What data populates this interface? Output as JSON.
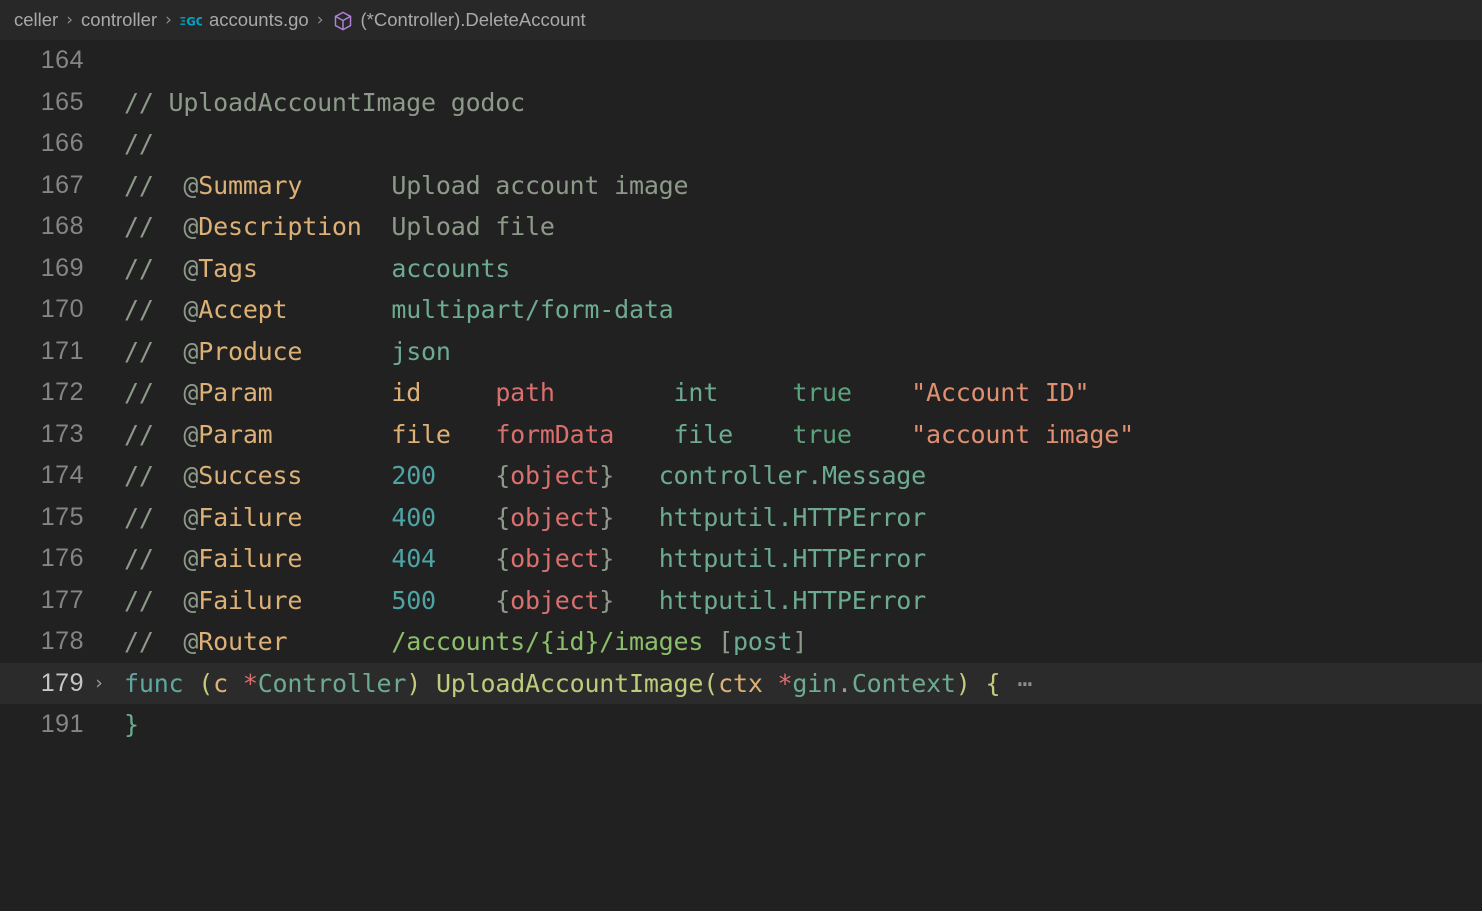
{
  "breadcrumb": {
    "separator": "›",
    "items": [
      {
        "label": "celler",
        "icon": null
      },
      {
        "label": "controller",
        "icon": null
      },
      {
        "label": "accounts.go",
        "icon": "go-file-icon"
      },
      {
        "label": "(*Controller).DeleteAccount",
        "icon": "symbol-cube-icon"
      }
    ]
  },
  "editor": {
    "fold_chevron": "›",
    "fold_ellipsis": "⋯",
    "lines": [
      {
        "num": "164",
        "fold": false,
        "folded": false,
        "tokens": []
      },
      {
        "num": "165",
        "fold": false,
        "folded": false,
        "tokens": [
          {
            "c": "t-comment",
            "t": "// UploadAccountImage godoc"
          }
        ]
      },
      {
        "num": "166",
        "fold": false,
        "folded": false,
        "tokens": [
          {
            "c": "t-comment",
            "t": "//"
          }
        ]
      },
      {
        "num": "167",
        "fold": false,
        "folded": false,
        "tokens": [
          {
            "c": "t-comment",
            "t": "//  @"
          },
          {
            "c": "t-tag",
            "t": "Summary"
          },
          {
            "c": "t-comment",
            "t": "      Upload account image"
          }
        ]
      },
      {
        "num": "168",
        "fold": false,
        "folded": false,
        "tokens": [
          {
            "c": "t-comment",
            "t": "//  @"
          },
          {
            "c": "t-tag",
            "t": "Description"
          },
          {
            "c": "t-comment",
            "t": "  Upload file"
          }
        ]
      },
      {
        "num": "169",
        "fold": false,
        "folded": false,
        "tokens": [
          {
            "c": "t-comment",
            "t": "//  @"
          },
          {
            "c": "t-tag",
            "t": "Tags"
          },
          {
            "c": "t-comment",
            "t": "         "
          },
          {
            "c": "t-type",
            "t": "accounts"
          }
        ]
      },
      {
        "num": "170",
        "fold": false,
        "folded": false,
        "tokens": [
          {
            "c": "t-comment",
            "t": "//  @"
          },
          {
            "c": "t-tag",
            "t": "Accept"
          },
          {
            "c": "t-comment",
            "t": "       "
          },
          {
            "c": "t-type",
            "t": "multipart/form-data"
          }
        ]
      },
      {
        "num": "171",
        "fold": false,
        "folded": false,
        "tokens": [
          {
            "c": "t-comment",
            "t": "//  @"
          },
          {
            "c": "t-tag",
            "t": "Produce"
          },
          {
            "c": "t-comment",
            "t": "      "
          },
          {
            "c": "t-type",
            "t": "json"
          }
        ]
      },
      {
        "num": "172",
        "fold": false,
        "folded": false,
        "tokens": [
          {
            "c": "t-comment",
            "t": "//  @"
          },
          {
            "c": "t-tag",
            "t": "Param"
          },
          {
            "c": "t-comment",
            "t": "        "
          },
          {
            "c": "t-param",
            "t": "id"
          },
          {
            "c": "t-comment",
            "t": "     "
          },
          {
            "c": "t-salmon",
            "t": "path"
          },
          {
            "c": "t-comment",
            "t": "        "
          },
          {
            "c": "t-type",
            "t": "int"
          },
          {
            "c": "t-comment",
            "t": "     "
          },
          {
            "c": "t-bool",
            "t": "true"
          },
          {
            "c": "t-comment",
            "t": "    "
          },
          {
            "c": "t-string",
            "t": "\"Account ID\""
          }
        ]
      },
      {
        "num": "173",
        "fold": false,
        "folded": false,
        "tokens": [
          {
            "c": "t-comment",
            "t": "//  @"
          },
          {
            "c": "t-tag",
            "t": "Param"
          },
          {
            "c": "t-comment",
            "t": "        "
          },
          {
            "c": "t-param",
            "t": "file"
          },
          {
            "c": "t-comment",
            "t": "   "
          },
          {
            "c": "t-salmon",
            "t": "formData"
          },
          {
            "c": "t-comment",
            "t": "    "
          },
          {
            "c": "t-type",
            "t": "file"
          },
          {
            "c": "t-comment",
            "t": "    "
          },
          {
            "c": "t-bool",
            "t": "true"
          },
          {
            "c": "t-comment",
            "t": "    "
          },
          {
            "c": "t-string",
            "t": "\"account image\""
          }
        ]
      },
      {
        "num": "174",
        "fold": false,
        "folded": false,
        "tokens": [
          {
            "c": "t-comment",
            "t": "//  @"
          },
          {
            "c": "t-tag",
            "t": "Success"
          },
          {
            "c": "t-comment",
            "t": "      "
          },
          {
            "c": "t-number",
            "t": "200"
          },
          {
            "c": "t-comment",
            "t": "    {"
          },
          {
            "c": "t-salmon",
            "t": "object"
          },
          {
            "c": "t-comment",
            "t": "}   "
          },
          {
            "c": "t-type",
            "t": "controller.Message"
          }
        ]
      },
      {
        "num": "175",
        "fold": false,
        "folded": false,
        "tokens": [
          {
            "c": "t-comment",
            "t": "//  @"
          },
          {
            "c": "t-tag",
            "t": "Failure"
          },
          {
            "c": "t-comment",
            "t": "      "
          },
          {
            "c": "t-number",
            "t": "400"
          },
          {
            "c": "t-comment",
            "t": "    {"
          },
          {
            "c": "t-salmon",
            "t": "object"
          },
          {
            "c": "t-comment",
            "t": "}   "
          },
          {
            "c": "t-type",
            "t": "httputil.HTTPError"
          }
        ]
      },
      {
        "num": "176",
        "fold": false,
        "folded": false,
        "tokens": [
          {
            "c": "t-comment",
            "t": "//  @"
          },
          {
            "c": "t-tag",
            "t": "Failure"
          },
          {
            "c": "t-comment",
            "t": "      "
          },
          {
            "c": "t-number",
            "t": "404"
          },
          {
            "c": "t-comment",
            "t": "    {"
          },
          {
            "c": "t-salmon",
            "t": "object"
          },
          {
            "c": "t-comment",
            "t": "}   "
          },
          {
            "c": "t-type",
            "t": "httputil.HTTPError"
          }
        ]
      },
      {
        "num": "177",
        "fold": false,
        "folded": false,
        "tokens": [
          {
            "c": "t-comment",
            "t": "//  @"
          },
          {
            "c": "t-tag",
            "t": "Failure"
          },
          {
            "c": "t-comment",
            "t": "      "
          },
          {
            "c": "t-number",
            "t": "500"
          },
          {
            "c": "t-comment",
            "t": "    {"
          },
          {
            "c": "t-salmon",
            "t": "object"
          },
          {
            "c": "t-comment",
            "t": "}   "
          },
          {
            "c": "t-type",
            "t": "httputil.HTTPError"
          }
        ]
      },
      {
        "num": "178",
        "fold": false,
        "folded": false,
        "tokens": [
          {
            "c": "t-comment",
            "t": "//  @"
          },
          {
            "c": "t-tag",
            "t": "Router"
          },
          {
            "c": "t-comment",
            "t": "       "
          },
          {
            "c": "t-path",
            "t": "/accounts/{id}/images"
          },
          {
            "c": "t-comment",
            "t": " ["
          },
          {
            "c": "t-type",
            "t": "post"
          },
          {
            "c": "t-comment",
            "t": "]"
          }
        ]
      },
      {
        "num": "179",
        "fold": true,
        "folded": true,
        "tokens": [
          {
            "c": "t-keyword",
            "t": "func"
          },
          {
            "c": "t-punct",
            "t": " "
          },
          {
            "c": "t-bracket1",
            "t": "("
          },
          {
            "c": "t-param",
            "t": "c"
          },
          {
            "c": "t-punct",
            "t": " "
          },
          {
            "c": "t-salmon",
            "t": "*"
          },
          {
            "c": "t-type",
            "t": "Controller"
          },
          {
            "c": "t-bracket1",
            "t": ")"
          },
          {
            "c": "t-punct",
            "t": " "
          },
          {
            "c": "t-func",
            "t": "UploadAccountImage"
          },
          {
            "c": "t-bracket1",
            "t": "("
          },
          {
            "c": "t-param",
            "t": "ctx"
          },
          {
            "c": "t-punct",
            "t": " "
          },
          {
            "c": "t-salmon",
            "t": "*"
          },
          {
            "c": "t-type",
            "t": "gin"
          },
          {
            "c": "t-punct",
            "t": "."
          },
          {
            "c": "t-type",
            "t": "Context"
          },
          {
            "c": "t-bracket1",
            "t": ")"
          },
          {
            "c": "t-punct",
            "t": " "
          },
          {
            "c": "t-bracket1",
            "t": "{"
          },
          {
            "c": "t-fold",
            "t": " ⋯"
          }
        ]
      },
      {
        "num": "191",
        "fold": false,
        "folded": false,
        "tokens": [
          {
            "c": "t-bracket2",
            "t": "}"
          }
        ]
      }
    ]
  },
  "colors": {
    "editor_background": "#212121",
    "breadcrumb_background": "#282828",
    "folded_line_background": "#2b2b2b",
    "line_number": "#858585",
    "active_line_number": "#c6c6c6",
    "comment": "#8d9a8a",
    "annotation_tag": "#ddb176",
    "string": "#e08f70",
    "type": "#6dab91",
    "number": "#4ea3a3",
    "boolean": "#5ba37d",
    "operator_star": "#d9706f",
    "route_path": "#8bbf6a",
    "bracket_level_1": "#c5c97b",
    "bracket_level_2": "#6dab91",
    "keyword": "#5fa8a0",
    "function_name": "#bfca7a",
    "go_icon": "#00a6c7",
    "symbol_cube_icon": "#b180d7"
  }
}
